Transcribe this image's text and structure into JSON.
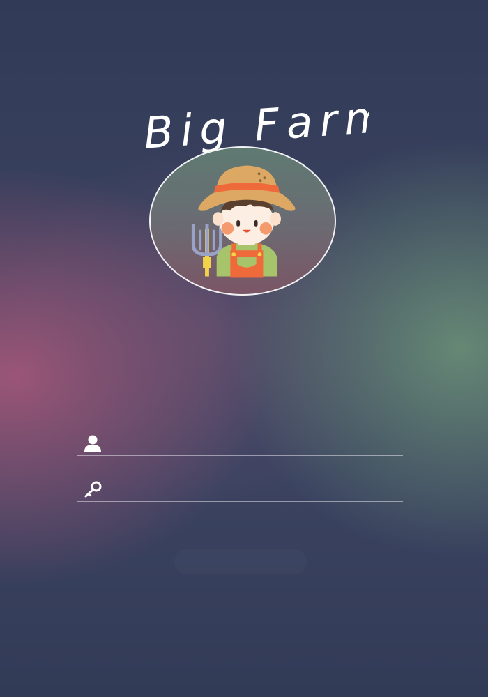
{
  "app": {
    "title": "Big Farm"
  },
  "login": {
    "username_value": "",
    "username_placeholder": "",
    "password_value": "",
    "password_placeholder": "",
    "submit_label": ""
  },
  "icons": {
    "username": "user-icon",
    "password": "key-icon",
    "avatar": "farmer-avatar"
  },
  "colors": {
    "background_top": "#313b57",
    "background_pink_glow": "#a05678",
    "background_green_glow": "#688c76",
    "title_text": "#ffffff",
    "avatar_border": "#f2f2f4",
    "hat": "#dda864",
    "hat_band": "#ee6a3a",
    "overalls": "#ee6a3a",
    "shirt": "#a8c46a",
    "field_underline": "#e6e1eb"
  }
}
